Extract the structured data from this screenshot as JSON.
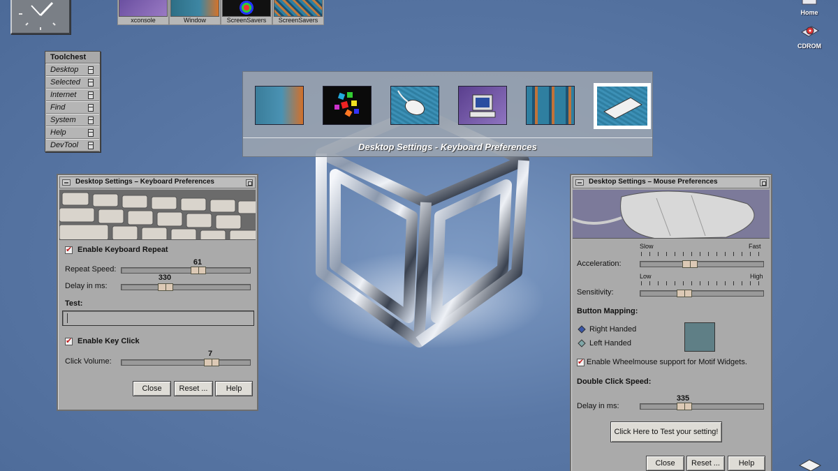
{
  "top_strip": {
    "items": [
      {
        "label": "xconsole",
        "icon": "keyboard-thumb"
      },
      {
        "label": "Window",
        "icon": "window-thumb"
      },
      {
        "label": "ScreenSavers",
        "icon": "screensaver-thumb"
      },
      {
        "label": "ScreenSavers",
        "icon": "pattern-thumb"
      }
    ]
  },
  "desktop_icons": {
    "home": "Home",
    "cdrom": "CDROM"
  },
  "toolchest": {
    "title": "Toolchest",
    "items": [
      "Desktop",
      "Selected",
      "Internet",
      "Find",
      "System",
      "Help",
      "DevTool"
    ]
  },
  "center_panel": {
    "caption": "Desktop Settings - Keyboard Preferences",
    "thumbs": [
      "window-thumb",
      "screensaver-thumb",
      "mouse-thumb",
      "monitor-thumb",
      "pattern-thumb",
      "keyboard-thumb"
    ],
    "selected_index": 5
  },
  "keyboard_window": {
    "title": "Desktop Settings – Keyboard Preferences",
    "enable_repeat": {
      "label": "Enable Keyboard Repeat",
      "checked": true
    },
    "repeat_speed": {
      "label": "Repeat Speed:",
      "value": "61",
      "fraction": 0.61
    },
    "delay": {
      "label": "Delay in ms:",
      "value": "330",
      "fraction": 0.38
    },
    "test_label": "Test:",
    "test_value": "",
    "enable_click": {
      "label": "Enable Key Click",
      "checked": true
    },
    "click_volume": {
      "label": "Click Volume:",
      "value": "7",
      "fraction": 0.7
    },
    "buttons": {
      "close": "Close",
      "reset": "Reset ...",
      "help": "Help"
    }
  },
  "mouse_window": {
    "title": "Desktop Settings – Mouse Preferences",
    "acceleration": {
      "label": "Acceleration:",
      "min_label": "Slow",
      "max_label": "Fast",
      "fraction": 0.4
    },
    "sensitivity": {
      "label": "Sensitivity:",
      "min_label": "Low",
      "max_label": "High",
      "fraction": 0.35
    },
    "button_mapping": {
      "heading": "Button Mapping:",
      "right": "Right Handed",
      "left": "Left Handed",
      "selected": "right"
    },
    "wheelmouse": {
      "label": "Enable Wheelmouse support for Motif Widgets.",
      "checked": true
    },
    "double_click": {
      "heading": "Double Click Speed:",
      "label": "Delay in ms:",
      "value": "335",
      "fraction": 0.35
    },
    "test_button": "Click Here to Test your setting!",
    "buttons": {
      "close": "Close",
      "reset": "Reset ...",
      "help": "Help"
    }
  },
  "colors": {
    "desktop": "#5a78a6",
    "panel": "#aaaaaa",
    "check": "#c21a1a",
    "swatch": "#5f7f86"
  }
}
